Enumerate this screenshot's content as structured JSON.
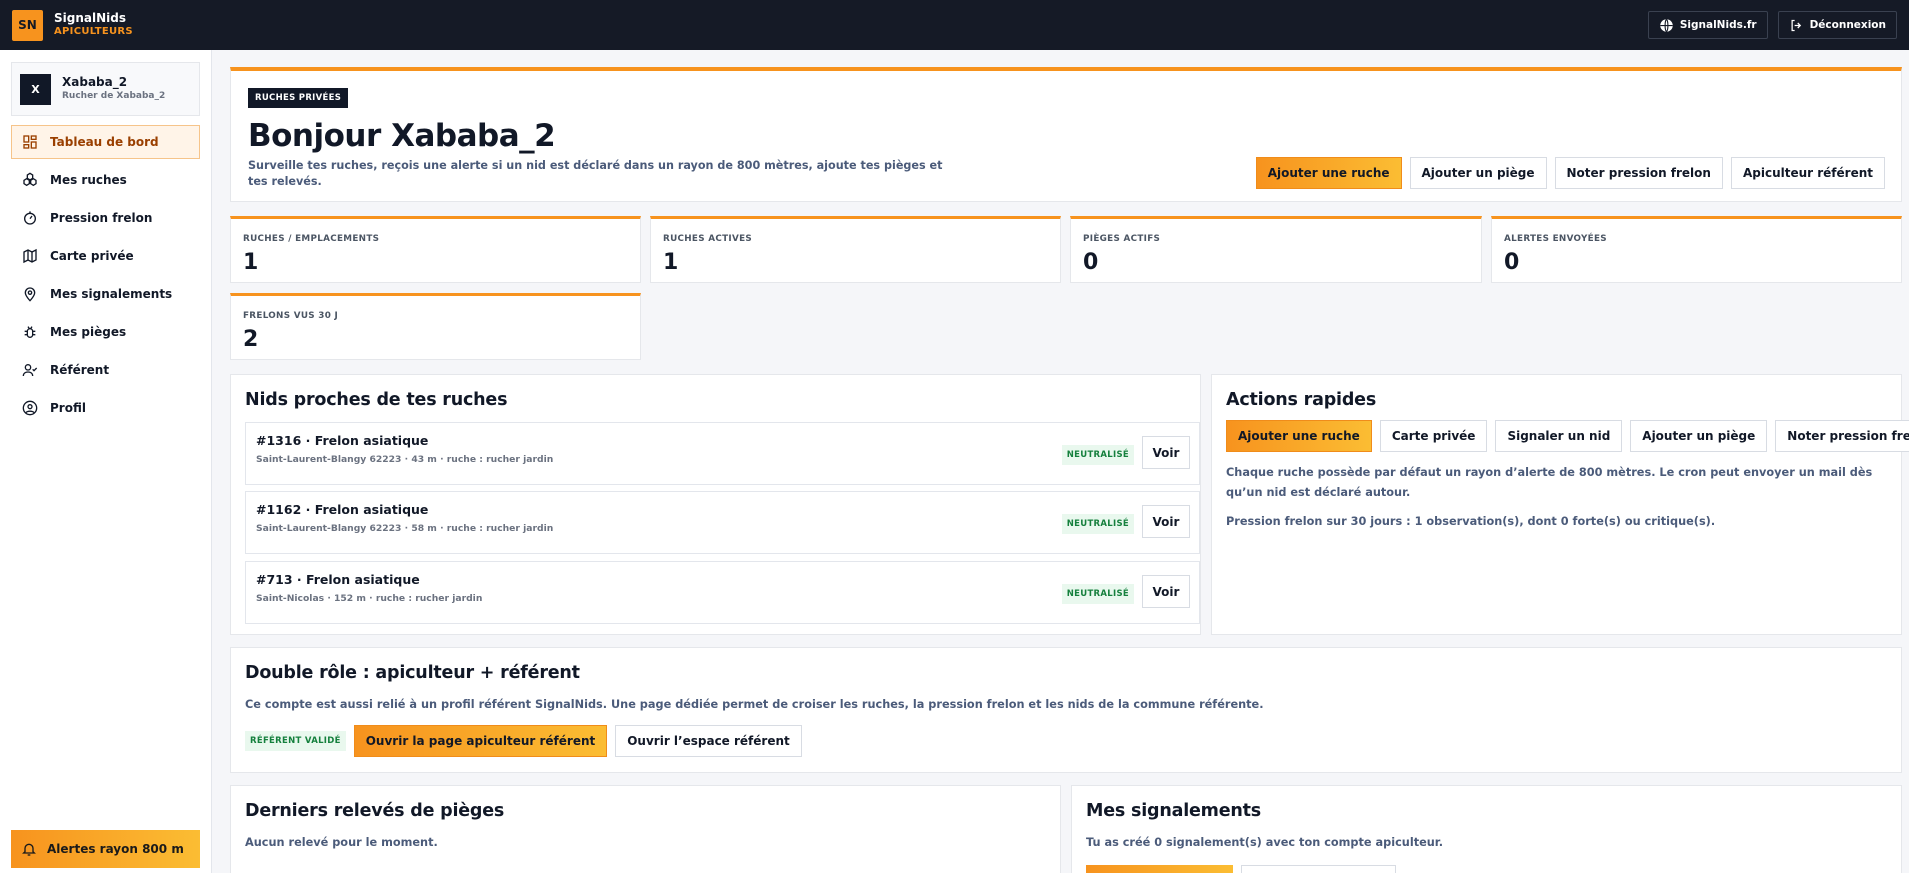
{
  "topbar": {
    "logo_text": "SN",
    "brand_name": "SignalNids",
    "brand_sub": "APICULTEURS",
    "site_link": "SignalNids.fr",
    "logout": "Déconnexion"
  },
  "user": {
    "avatar_letter": "X",
    "name": "Xababa_2",
    "subtitle": "Rucher de Xababa_2"
  },
  "sidebar": {
    "items": [
      {
        "label": "Tableau de bord",
        "icon": "dashboard-icon",
        "active": true
      },
      {
        "label": "Mes ruches",
        "icon": "hive-icon"
      },
      {
        "label": "Pression frelon",
        "icon": "gauge-icon"
      },
      {
        "label": "Carte privée",
        "icon": "map-icon"
      },
      {
        "label": "Mes signalements",
        "icon": "location-pin-icon"
      },
      {
        "label": "Mes pièges",
        "icon": "bug-icon"
      },
      {
        "label": "Référent",
        "icon": "user-check-icon"
      },
      {
        "label": "Profil",
        "icon": "user-circle-icon"
      }
    ],
    "alert_button": "Alertes rayon 800 m"
  },
  "hero": {
    "badge": "RUCHES PRIVÉES",
    "title": "Bonjour Xababa_2",
    "description": "Surveille tes ruches, reçois une alerte si un nid est déclaré dans un rayon de 800 mètres, ajoute tes pièges et tes relevés.",
    "actions": [
      "Ajouter une ruche",
      "Ajouter un piège",
      "Noter pression frelon",
      "Apiculteur référent"
    ]
  },
  "stats": [
    {
      "label": "RUCHES / EMPLACEMENTS",
      "value": "1"
    },
    {
      "label": "RUCHES ACTIVES",
      "value": "1"
    },
    {
      "label": "PIÈGES ACTIFS",
      "value": "0"
    },
    {
      "label": "ALERTES ENVOYÉES",
      "value": "0"
    },
    {
      "label": "FRELONS VUS 30 J",
      "value": "2"
    }
  ],
  "nests": {
    "title": "Nids proches de tes ruches",
    "items": [
      {
        "title": "#1316 · Frelon asiatique",
        "sub": "Saint-Laurent-Blangy 62223 · 43 m · ruche : rucher jardin",
        "status": "NEUTRALISÉ",
        "action": "Voir"
      },
      {
        "title": "#1162 · Frelon asiatique",
        "sub": "Saint-Laurent-Blangy 62223 · 58 m · ruche : rucher jardin",
        "status": "NEUTRALISÉ",
        "action": "Voir"
      },
      {
        "title": "#713 · Frelon asiatique",
        "sub": "Saint-Nicolas · 152 m · ruche : rucher jardin",
        "status": "NEUTRALISÉ",
        "action": "Voir"
      }
    ]
  },
  "quick_actions": {
    "title": "Actions rapides",
    "buttons": [
      "Ajouter une ruche",
      "Carte privée",
      "Signaler un nid",
      "Ajouter un piège",
      "Noter pression frelon"
    ],
    "info1": "Chaque ruche possède par défaut un rayon d’alerte de 800 mètres. Le cron peut envoyer un mail dès qu’un nid est déclaré autour.",
    "info2": "Pression frelon sur 30 jours : 1 observation(s), dont 0 forte(s) ou critique(s)."
  },
  "double_role": {
    "title": "Double rôle : apiculteur + référent",
    "text": "Ce compte est aussi relié à un profil référent SignalNids. Une page dédiée permet de croiser les ruches, la pression frelon et les nids de la commune référente.",
    "badge": "RÉFÉRENT VALIDÉ",
    "btn_primary": "Ouvrir la page apiculteur référent",
    "btn_secondary": "Ouvrir l’espace référent"
  },
  "traps": {
    "title": "Derniers relevés de pièges",
    "empty": "Aucun relevé pour le moment."
  },
  "reports": {
    "title": "Mes signalements",
    "text": "Tu as créé 0 signalement(s) avec ton compte apiculteur."
  },
  "colors": {
    "accent": "#f7931e",
    "topbar": "#151a26",
    "success": "#15803d"
  }
}
